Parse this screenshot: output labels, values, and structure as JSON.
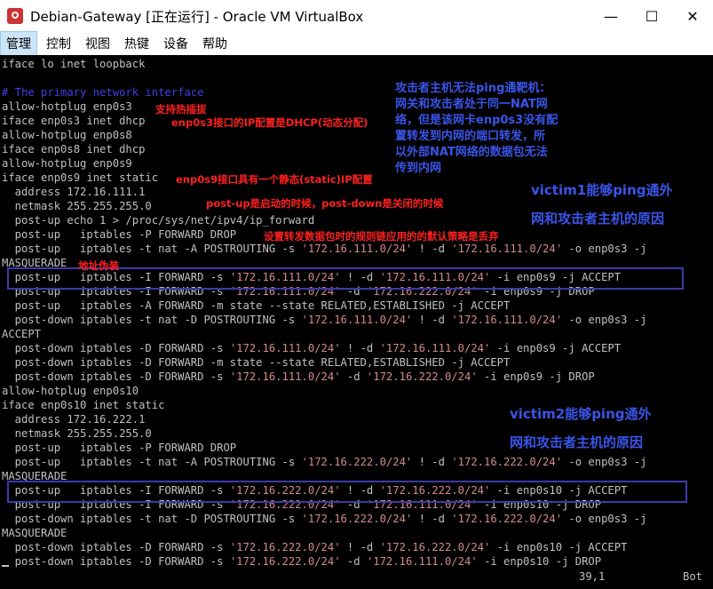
{
  "window": {
    "title": "Debian-Gateway [正在运行] - Oracle VM VirtualBox",
    "minimize": "—",
    "maximize": "☐",
    "close": "✕"
  },
  "menu": [
    "管理",
    "控制",
    "视图",
    "热键",
    "设备",
    "帮助"
  ],
  "terminal_lines": [
    [
      [
        "g",
        "iface lo inet loopback"
      ]
    ],
    [],
    [
      [
        "c",
        "# The primary network interface"
      ]
    ],
    [
      [
        "g",
        "allow-hotplug enp0s3"
      ]
    ],
    [
      [
        "g",
        "iface enp0s3 inet dhcp"
      ]
    ],
    [
      [
        "g",
        "allow-hotplug enp0s8"
      ]
    ],
    [
      [
        "g",
        "iface enp0s8 inet dhcp"
      ]
    ],
    [
      [
        "g",
        "allow-hotplug enp0s9"
      ]
    ],
    [
      [
        "g",
        "iface enp0s9 inet static"
      ]
    ],
    [
      [
        "g",
        "  address 172.16.111.1"
      ]
    ],
    [
      [
        "g",
        "  netmask 255.255.255.0"
      ]
    ],
    [
      [
        "g",
        "  post-up echo 1 > /proc/sys/net/ipv4/ip_forward"
      ]
    ],
    [
      [
        "g",
        "  post-up   iptables -P FORWARD DROP"
      ]
    ],
    [
      [
        "g",
        "  post-up   iptables -t nat -A POSTROUTING -s "
      ],
      [
        "s",
        "'172.16.111.0/24'"
      ],
      [
        "g",
        " ! -d "
      ],
      [
        "s",
        "'172.16.111.0/24'"
      ],
      [
        "g",
        " -o enp0s3 -j"
      ]
    ],
    [
      [
        "g",
        "MASQUERADE"
      ]
    ],
    [
      [
        "g",
        "  post-up   iptables -I FORWARD -s "
      ],
      [
        "s",
        "'172.16.111.0/24'"
      ],
      [
        "g",
        " ! -d "
      ],
      [
        "s",
        "'172.16.111.0/24'"
      ],
      [
        "g",
        " -i enp0s9 -j ACCEPT"
      ]
    ],
    [
      [
        "g",
        "  post-up   iptables -I FORWARD -s "
      ],
      [
        "s",
        "'172.16.111.0/24'"
      ],
      [
        "g",
        " -d "
      ],
      [
        "s",
        "'172.16.222.0/24'"
      ],
      [
        "g",
        " -i enp0s9 -j DROP"
      ]
    ],
    [
      [
        "g",
        "  post-up   iptables -A FORWARD -m state --state RELATED,ESTABLISHED -j ACCEPT"
      ]
    ],
    [
      [
        "g",
        "  post-down iptables -t nat -D POSTROUTING -s "
      ],
      [
        "s",
        "'172.16.111.0/24'"
      ],
      [
        "g",
        " ! -d "
      ],
      [
        "s",
        "'172.16.111.0/24'"
      ],
      [
        "g",
        " -o enp0s3 -j"
      ]
    ],
    [
      [
        "g",
        "ACCEPT"
      ]
    ],
    [
      [
        "g",
        "  post-down iptables -D FORWARD -s "
      ],
      [
        "s",
        "'172.16.111.0/24'"
      ],
      [
        "g",
        " ! -d "
      ],
      [
        "s",
        "'172.16.111.0/24'"
      ],
      [
        "g",
        " -i enp0s9 -j ACCEPT"
      ]
    ],
    [
      [
        "g",
        "  post-down iptables -D FORWARD -m state --state RELATED,ESTABLISHED -j ACCEPT"
      ]
    ],
    [
      [
        "g",
        "  post-down iptables -D FORWARD -s "
      ],
      [
        "s",
        "'172.16.111.0/24'"
      ],
      [
        "g",
        " -d "
      ],
      [
        "s",
        "'172.16.222.0/24'"
      ],
      [
        "g",
        " -i enp0s9 -j DROP"
      ]
    ],
    [
      [
        "g",
        "allow-hotplug enp0s10"
      ]
    ],
    [
      [
        "g",
        "iface enp0s10 inet static"
      ]
    ],
    [
      [
        "g",
        "  address 172.16.222.1"
      ]
    ],
    [
      [
        "g",
        "  netmask 255.255.255.0"
      ]
    ],
    [
      [
        "g",
        "  post-up   iptables -P FORWARD DROP"
      ]
    ],
    [
      [
        "g",
        "  post-up   iptables -t nat -A POSTROUTING -s "
      ],
      [
        "s",
        "'172.16.222.0/24'"
      ],
      [
        "g",
        " ! -d "
      ],
      [
        "s",
        "'172.16.222.0/24'"
      ],
      [
        "g",
        " -o enp0s3 -j"
      ]
    ],
    [
      [
        "g",
        "MASQUERADE"
      ]
    ],
    [
      [
        "g",
        "  post-up   iptables -I FORWARD -s "
      ],
      [
        "s",
        "'172.16.222.0/24'"
      ],
      [
        "g",
        " ! -d "
      ],
      [
        "s",
        "'172.16.222.0/24'"
      ],
      [
        "g",
        " -i enp0s10 -j ACCEPT"
      ]
    ],
    [
      [
        "g",
        "  post-up   iptables -I FORWARD -s "
      ],
      [
        "s",
        "'172.16.222.0/24'"
      ],
      [
        "g",
        " -d "
      ],
      [
        "s",
        "'172.16.111.0/24'"
      ],
      [
        "g",
        " -i enp0s10 -j DROP"
      ]
    ],
    [
      [
        "g",
        "  post-down iptables -t nat -D POSTROUTING -s "
      ],
      [
        "s",
        "'172.16.222.0/24'"
      ],
      [
        "g",
        " ! -d "
      ],
      [
        "s",
        "'172.16.222.0/24'"
      ],
      [
        "g",
        " -o enp0s3 -j"
      ]
    ],
    [
      [
        "g",
        "MASQUERADE"
      ]
    ],
    [
      [
        "g",
        "  post-down iptables -D FORWARD -s "
      ],
      [
        "s",
        "'172.16.222.0/24'"
      ],
      [
        "g",
        " ! -d "
      ],
      [
        "s",
        "'172.16.222.0/24'"
      ],
      [
        "g",
        " -i enp0s10 -j ACCEPT"
      ]
    ],
    [
      [
        "g",
        "  post-down iptables -D FORWARD -s "
      ],
      [
        "s",
        "'172.16.222.0/24'"
      ],
      [
        "g",
        " -d "
      ],
      [
        "s",
        "'172.16.111.0/24'"
      ],
      [
        "g",
        " -i enp0s10 -j DROP"
      ]
    ]
  ],
  "annotations": {
    "hotplug": "支持热插拔",
    "dhcp": "enp0s3接口的IP配置是DHCP(动态分配)",
    "static": "enp0s9接口具有一个静态(static)IP配置",
    "postupdown": "post-up是启动的时候，post-down是关闭的时候",
    "policy": "设置转发数据包时的规则链应用的的默认策略是丢弃",
    "masq": "地址伪装",
    "attacker_note": "攻击者主机无法ping通靶机：\n网关和攻击者处于同一NAT网\n络，但是该网卡enp0s3没有配\n置转发到内网的端口转发，所\n以外部NAT网络的数据包无法\n传到内网",
    "victim1": "victim1能够ping通外\n网和攻击者主机的原因",
    "victim2": "victim2能够ping通外\n网和攻击者主机的原因"
  },
  "status": {
    "position": "39,1",
    "scroll": "Bot"
  },
  "colors": {
    "terminal_bg": "#000000",
    "text": "#c0c0c0",
    "comment": "#4040e0",
    "string": "#d08a8a",
    "annotation_red": "#ff2020",
    "annotation_blue": "#3a55e8"
  }
}
